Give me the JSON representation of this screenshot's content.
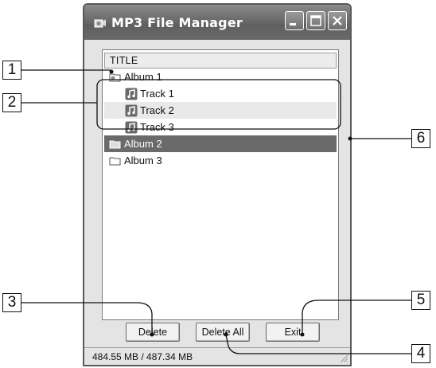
{
  "window": {
    "title": "MP3 File Manager"
  },
  "list": {
    "column_header": "TITLE",
    "items": [
      {
        "label": "Album 1",
        "kind": "album"
      },
      {
        "label": "Track 1",
        "kind": "track"
      },
      {
        "label": "Track 2",
        "kind": "track"
      },
      {
        "label": "Track 3",
        "kind": "track"
      },
      {
        "label": "Album 2",
        "kind": "album"
      },
      {
        "label": "Album 3",
        "kind": "album"
      }
    ]
  },
  "buttons": {
    "delete": "Delete",
    "delete_all": "Delete All",
    "exit": "Exit"
  },
  "status": {
    "storage": "484.55 MB / 487.34 MB"
  },
  "callouts": [
    "1",
    "2",
    "3",
    "4",
    "5",
    "6"
  ],
  "colors": {
    "titlebar": "#6f6f6f",
    "selection": "#6a6a6a"
  }
}
